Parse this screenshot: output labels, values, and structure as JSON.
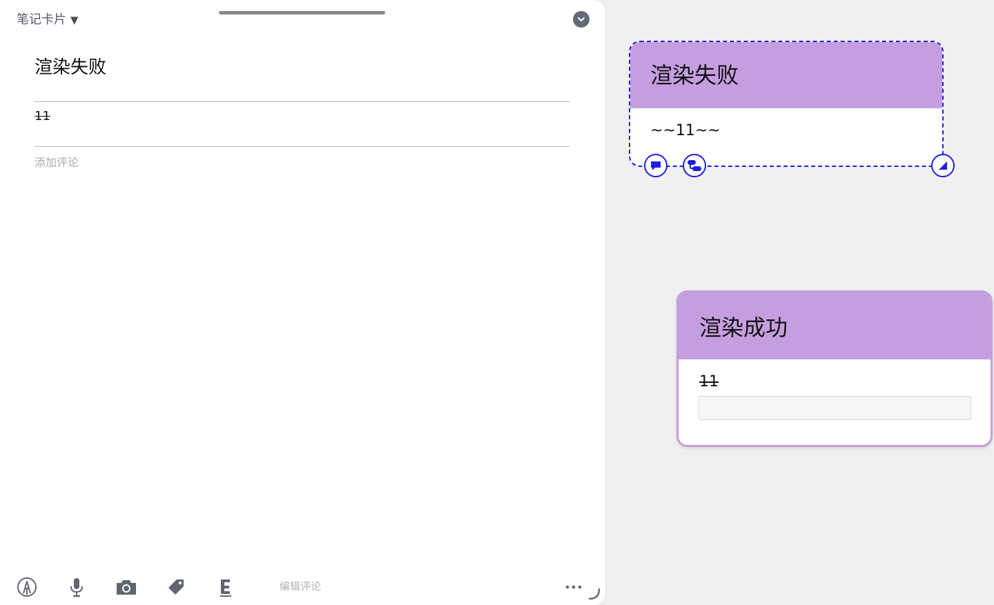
{
  "panel": {
    "title": "笔记卡片",
    "caret": "▼",
    "note_title": "渲染失败",
    "note_body": "11",
    "comment_placeholder": "添加评论",
    "toolbar": {
      "edit_comment_label": "编辑评论",
      "icons": [
        "pen-icon",
        "microphone-icon",
        "camera-icon",
        "tag-icon",
        "text-format-icon",
        "more-icon"
      ]
    }
  },
  "canvas": {
    "cards": [
      {
        "title": "渲染失败",
        "body": "~~11~~",
        "state": "selected"
      },
      {
        "title": "渲染成功",
        "body": "11"
      }
    ]
  },
  "colors": {
    "card_header": "#c59ee0",
    "selection": "#1f1fe0",
    "panel_bg": "#ffffff",
    "canvas_bg": "#f0f0f0"
  }
}
